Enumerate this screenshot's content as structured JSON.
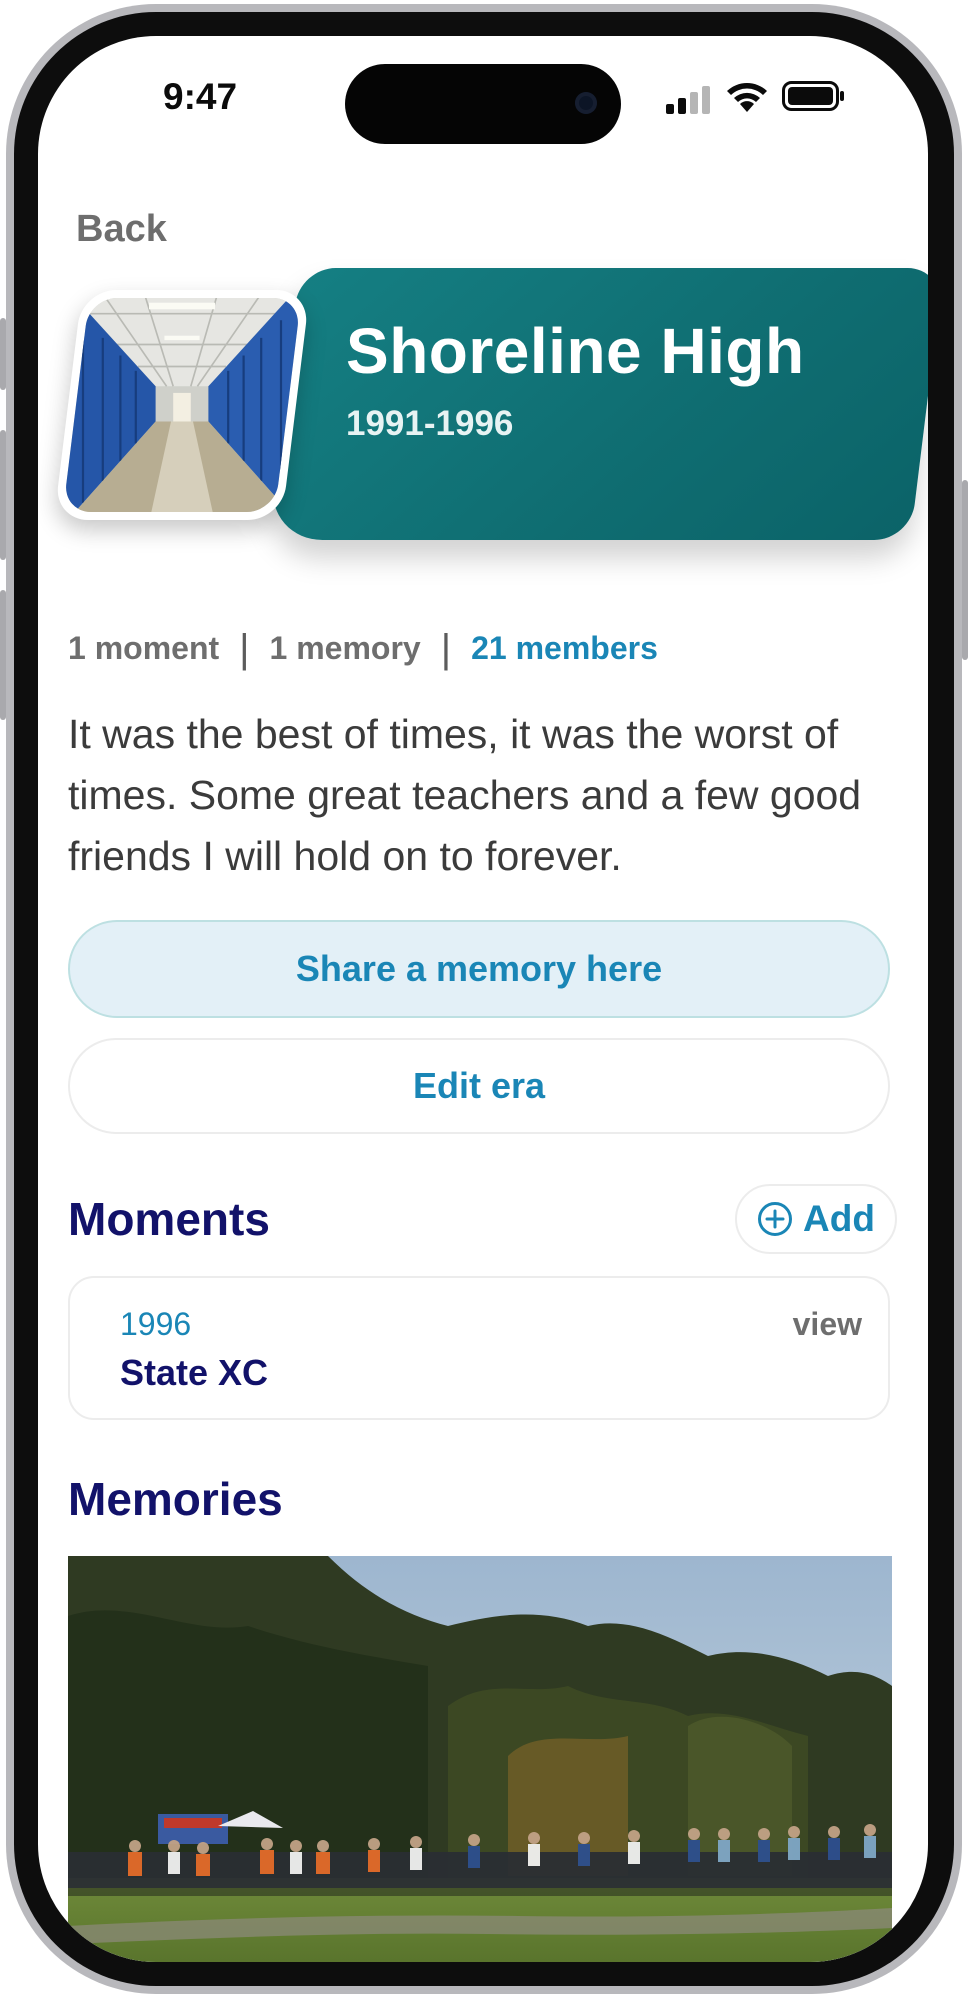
{
  "status_bar": {
    "time": "9:47"
  },
  "nav": {
    "back_label": "Back"
  },
  "era": {
    "title": "Shoreline High",
    "years": "1991-1996",
    "image_alt": "school hallway with blue lockers",
    "accent_color": "#127478"
  },
  "stats": {
    "moments": "1 moment",
    "memories": "1 memory",
    "members": "21 members"
  },
  "description": "It was the best of times, it was the worst of times. Some great teachers and a few good friends I will hold on to forever.",
  "actions": {
    "share_label": "Share a memory here",
    "edit_label": "Edit era"
  },
  "moments": {
    "heading": "Moments",
    "add_label": "Add",
    "items": [
      {
        "year": "1996",
        "title": "State XC",
        "view_label": "view"
      }
    ]
  },
  "memories": {
    "heading": "Memories",
    "items": [
      {
        "image_alt": "cross country race start with many runners on a grass field in front of trees"
      }
    ]
  },
  "colors": {
    "link_blue": "#1a86b6",
    "heading_navy": "#12126a",
    "muted_gray": "#6e6e6e",
    "share_bg": "#e3f0f7"
  }
}
